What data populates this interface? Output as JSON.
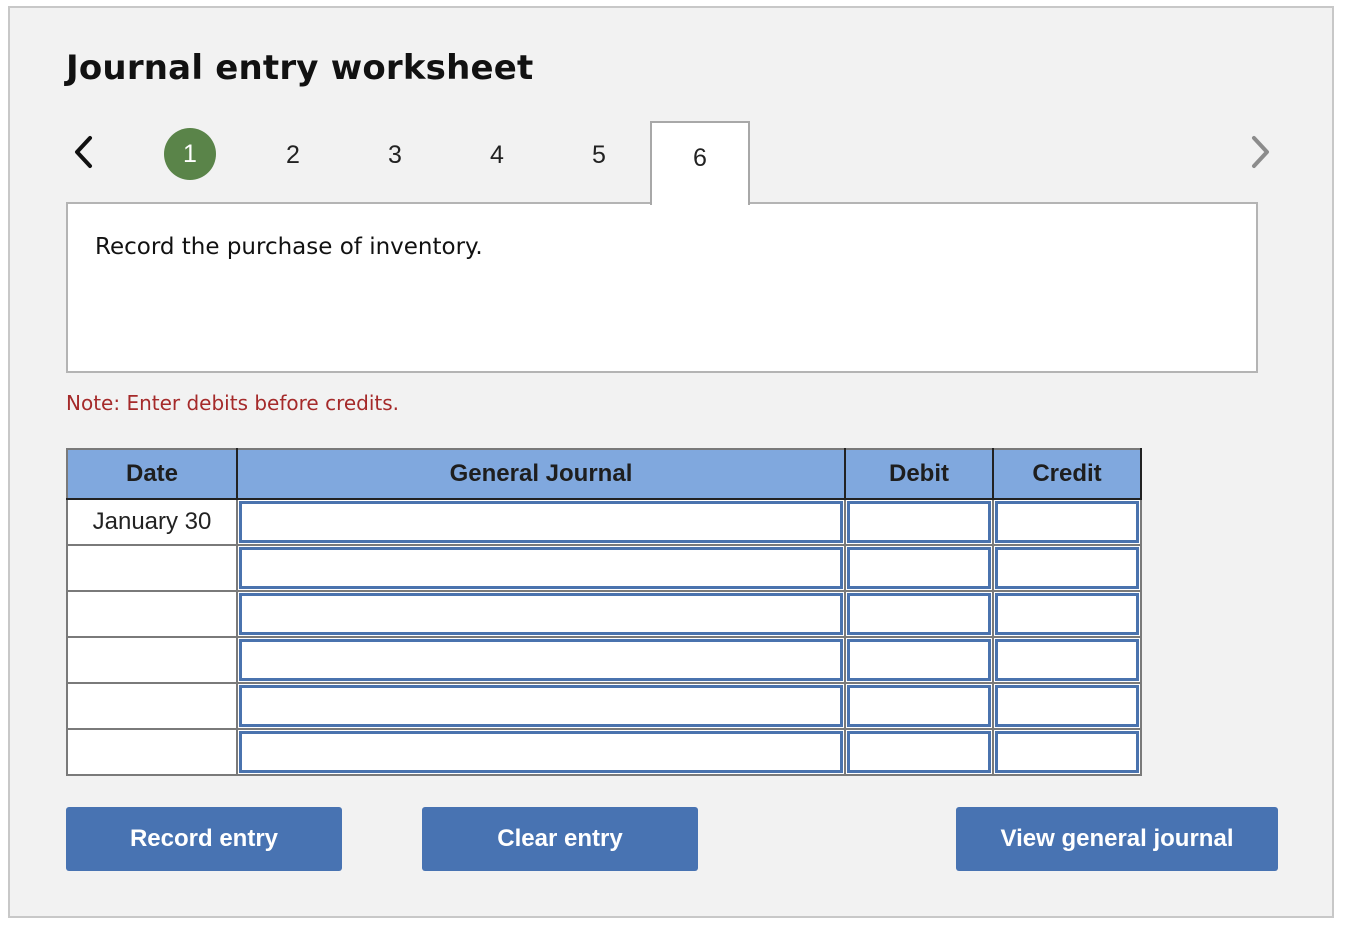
{
  "worksheet": {
    "title": "Journal entry worksheet",
    "nav": {
      "prev_icon": "chevron-left-icon",
      "next_icon": "chevron-right-icon",
      "steps": [
        {
          "label": "1",
          "state": "completed"
        },
        {
          "label": "2",
          "state": "default"
        },
        {
          "label": "3",
          "state": "default"
        },
        {
          "label": "4",
          "state": "default"
        },
        {
          "label": "5",
          "state": "default"
        },
        {
          "label": "6",
          "state": "active"
        }
      ]
    },
    "prompt": "Record the purchase of inventory.",
    "note": "Note: Enter debits before credits.",
    "colors": {
      "completed_step": "#5a8449",
      "header_bg": "#80a8de",
      "button_bg": "#4873b2",
      "note_text": "#a52a2a",
      "field_border": "#4a73ae"
    }
  },
  "journal_table": {
    "headers": [
      "Date",
      "General Journal",
      "Debit",
      "Credit"
    ],
    "rows": [
      {
        "date": "January 30",
        "account": "",
        "debit": "",
        "credit": ""
      },
      {
        "date": "",
        "account": "",
        "debit": "",
        "credit": ""
      },
      {
        "date": "",
        "account": "",
        "debit": "",
        "credit": ""
      },
      {
        "date": "",
        "account": "",
        "debit": "",
        "credit": ""
      },
      {
        "date": "",
        "account": "",
        "debit": "",
        "credit": ""
      },
      {
        "date": "",
        "account": "",
        "debit": "",
        "credit": ""
      }
    ]
  },
  "buttons": {
    "record": "Record entry",
    "clear": "Clear entry",
    "view": "View general journal"
  }
}
